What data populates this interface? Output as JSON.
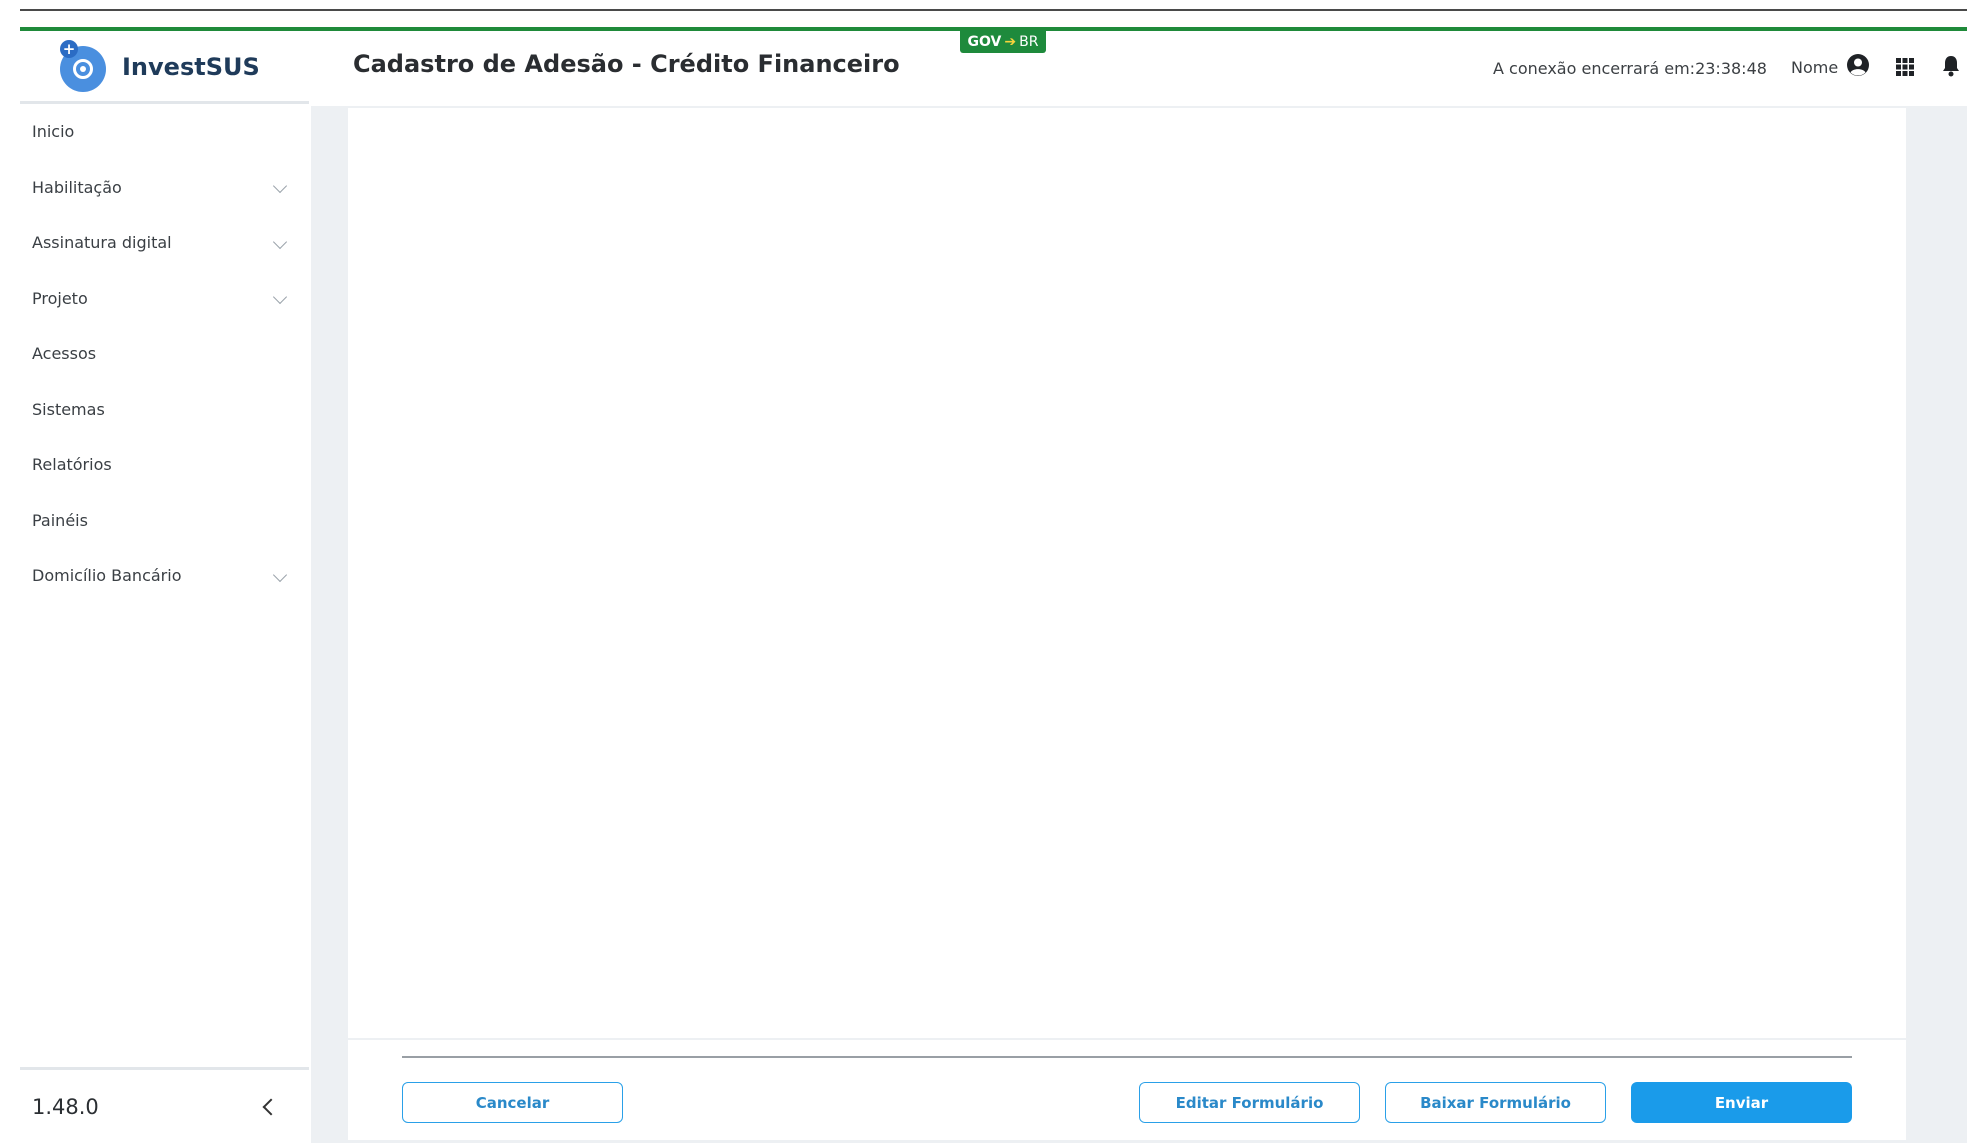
{
  "gov_badge": {
    "gov": "GOV",
    "br": "BR"
  },
  "app": {
    "name": "InvestSUS",
    "version": "1.48.0"
  },
  "header": {
    "title": "Cadastro de Adesão - Crédito Financeiro",
    "connection_label": "A conexão encerrará em:",
    "connection_time": "23:38:48",
    "user_label": "Nome"
  },
  "sidebar": {
    "items": [
      {
        "label": "Inicio"
      },
      {
        "label": "Habilitação"
      },
      {
        "label": "Assinatura digital"
      },
      {
        "label": "Projeto"
      },
      {
        "label": "Acessos"
      },
      {
        "label": "Sistemas"
      },
      {
        "label": "Relatórios"
      },
      {
        "label": "Painéis"
      },
      {
        "label": "Domicílio Bancário"
      }
    ]
  },
  "actions": {
    "cancel": "Cancelar",
    "edit": "Editar Formulário",
    "download": "Baixar Formulário",
    "send": "Enviar"
  },
  "colors": {
    "accent": "#1a9bea",
    "gov_green": "#1e8a3c",
    "background": "#edf0f3"
  }
}
